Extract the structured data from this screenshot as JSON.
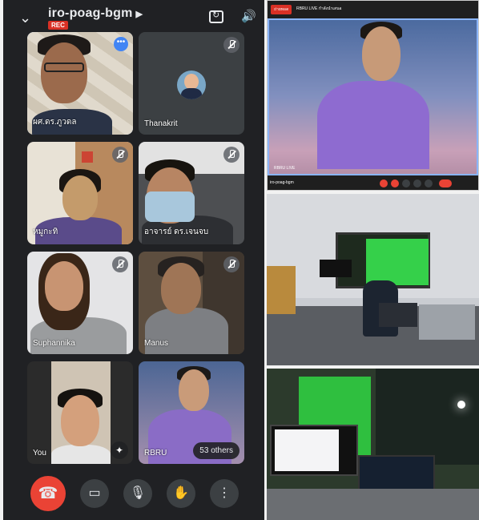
{
  "meet": {
    "room_name": "iro-poag-bgm",
    "rec_label": "REC",
    "others_count": "53 others",
    "participants": [
      {
        "name": "ผศ.ดร.ภูวดล"
      },
      {
        "name": "Thanakrit"
      },
      {
        "name": "หมูกะทิ"
      },
      {
        "name": "อาจารย์ ดร.เจนจบ"
      },
      {
        "name": "Suphannika"
      },
      {
        "name": "Manus"
      },
      {
        "name": "You"
      },
      {
        "name": "RBRU"
      }
    ]
  },
  "stream": {
    "live_label": "ถ่ายทอด",
    "channel_name": "RBRU LIVE กำลังนำเสนอ",
    "caption": "RBRU LIVE",
    "meeting_title": "iro-poag-bgm"
  },
  "colors": {
    "end_call": "#ea4335",
    "meet_bg": "#202124",
    "accent": "#8ab4f8"
  }
}
